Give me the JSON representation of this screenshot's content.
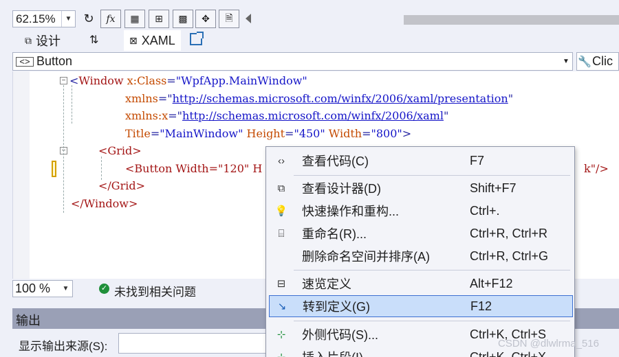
{
  "toolbar": {
    "zoom": "62.15%",
    "buttons": [
      "refresh-icon",
      "fx-icon",
      "grid-icon",
      "snap-grid-icon",
      "checker-icon",
      "snapline-icon",
      "file-icon"
    ]
  },
  "tabs": {
    "design": "设计",
    "xaml": "XAML"
  },
  "selector": {
    "element": "Button",
    "event": "Clic"
  },
  "code": {
    "l1_open": "<",
    "l1_tag": "Window",
    "l1_attr": " x:Class",
    "l1_eq": "=",
    "l1_val": "\"WpfApp.MainWindow\"",
    "l2_attr": "xmlns",
    "l2_val": "http://schemas.microsoft.com/winfx/2006/xaml/presentation",
    "l3_attr": "xmlns:x",
    "l3_val": "http://schemas.microsoft.com/winfx/2006/xaml",
    "l4_a1": "Title",
    "l4_v1": "\"MainWindow\"",
    "l4_a2": " Height",
    "l4_v2": "\"450\"",
    "l4_a3": " Width",
    "l4_v3": "\"800\"",
    "l4_close": ">",
    "l5": "<Grid>",
    "l6_start": "<Button Width=\"120\" H",
    "l6_end": "k\"/>",
    "l7": "</Grid>",
    "l8": "</Window>"
  },
  "editor_status": {
    "zoom": "100 %",
    "issues": "未找到相关问题"
  },
  "output": {
    "title": "输出",
    "source_label": "显示输出来源(S):",
    "source_value": ""
  },
  "context_menu": [
    {
      "icon": "code-brackets-icon",
      "label": "查看代码(C)",
      "shortcut": "F7"
    },
    {
      "icon": "view-designer-icon",
      "label": "查看设计器(D)",
      "shortcut": "Shift+F7"
    },
    {
      "icon": "lightbulb-icon",
      "label": "快速操作和重构...",
      "shortcut": "Ctrl+."
    },
    {
      "icon": "rename-icon",
      "label": "重命名(R)...",
      "shortcut": "Ctrl+R, Ctrl+R"
    },
    {
      "icon": "",
      "label": "删除命名空间并排序(A)",
      "shortcut": "Ctrl+R, Ctrl+G"
    },
    {
      "icon": "peek-definition-icon",
      "label": "速览定义",
      "shortcut": "Alt+F12"
    },
    {
      "icon": "go-to-definition-icon",
      "label": "转到定义(G)",
      "shortcut": "F12"
    },
    {
      "icon": "surround-with-icon",
      "label": "外侧代码(S)...",
      "shortcut": "Ctrl+K, Ctrl+S"
    },
    {
      "icon": "insert-snippet-icon",
      "label": "插入片段(I)",
      "shortcut": "Ctrl+K, Ctrl+X"
    }
  ],
  "watermark": "CSDN @dlwlrma_516"
}
